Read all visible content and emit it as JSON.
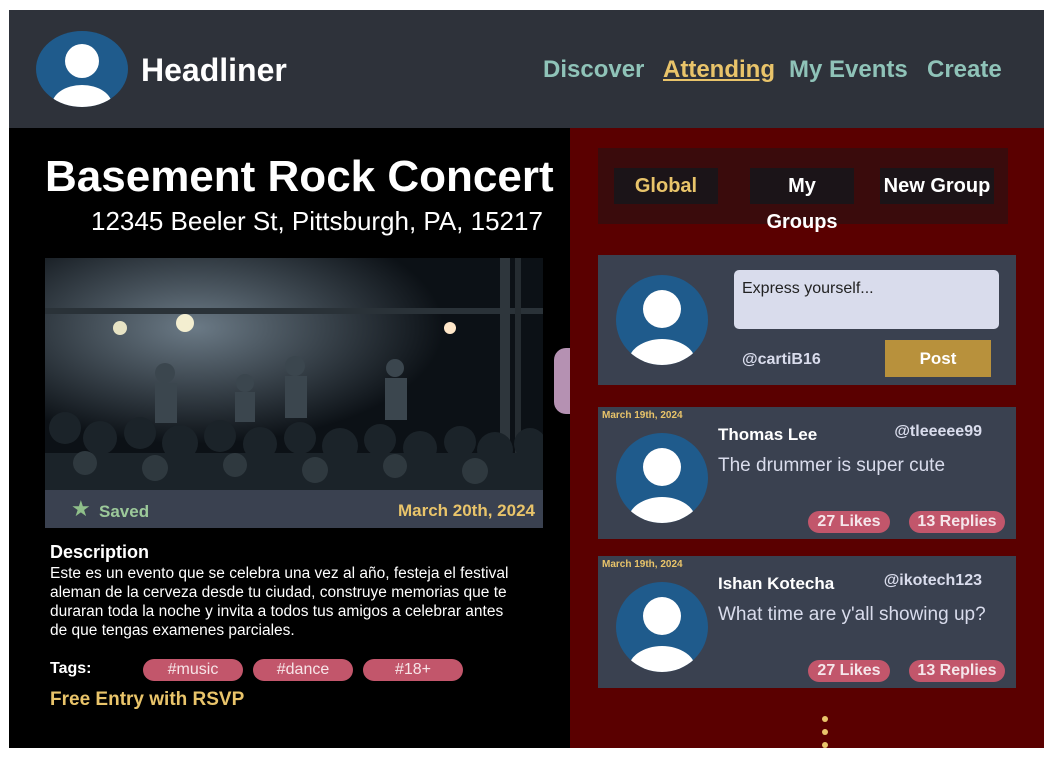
{
  "app": {
    "brand": "Headliner",
    "nav": [
      {
        "label": "Discover",
        "active": false
      },
      {
        "label": "Attending",
        "active": true
      },
      {
        "label": "My Events",
        "active": false
      },
      {
        "label": "Create",
        "active": false
      }
    ]
  },
  "event": {
    "title": "Basement Rock Concert",
    "address": "12345 Beeler St, Pittsburgh, PA, 15217",
    "saved_label": "Saved",
    "date": "March 20th, 2024",
    "description_heading": "Description",
    "description": "Este es un evento que se celebra una vez al año, festeja el festival aleman de la cerveza desde tu ciudad, construye memorias que te duraran toda la noche y invita a todos tus amigos a celebrar antes de que tengas examenes parciales.",
    "tags_label": "Tags:",
    "tags": [
      "#music",
      "#dance",
      "#18+"
    ],
    "entry_note": "Free Entry with RSVP"
  },
  "feed": {
    "tabs": [
      "Global",
      "My Groups",
      "New Group"
    ],
    "active_tab": "Global",
    "composer": {
      "placeholder": "Express yourself...",
      "username": "@cartiB16",
      "post_label": "Post"
    },
    "posts": [
      {
        "date": "March 19th, 2024",
        "name": "Thomas Lee",
        "handle": "@tleeeee99",
        "text": "The drummer is super cute",
        "likes": "27 Likes",
        "replies": "13 Replies"
      },
      {
        "date": "March 19th, 2024",
        "name": "Ishan Kotecha",
        "handle": "@ikotech123",
        "text": "What time are y'all showing up?",
        "likes": "27 Likes",
        "replies": "13 Replies"
      }
    ]
  },
  "colors": {
    "accent": "#e9c46a",
    "nav": "#8fc3b8",
    "header_bg": "#2e323a",
    "feed_bg": "#5a0000",
    "card_bg": "#3a4150",
    "pill": "#c2566b",
    "post_button": "#b8913c"
  },
  "icons": {
    "user_avatar": "user-avatar-icon",
    "saved": "star-icon",
    "more": "vertical-dots-icon"
  }
}
